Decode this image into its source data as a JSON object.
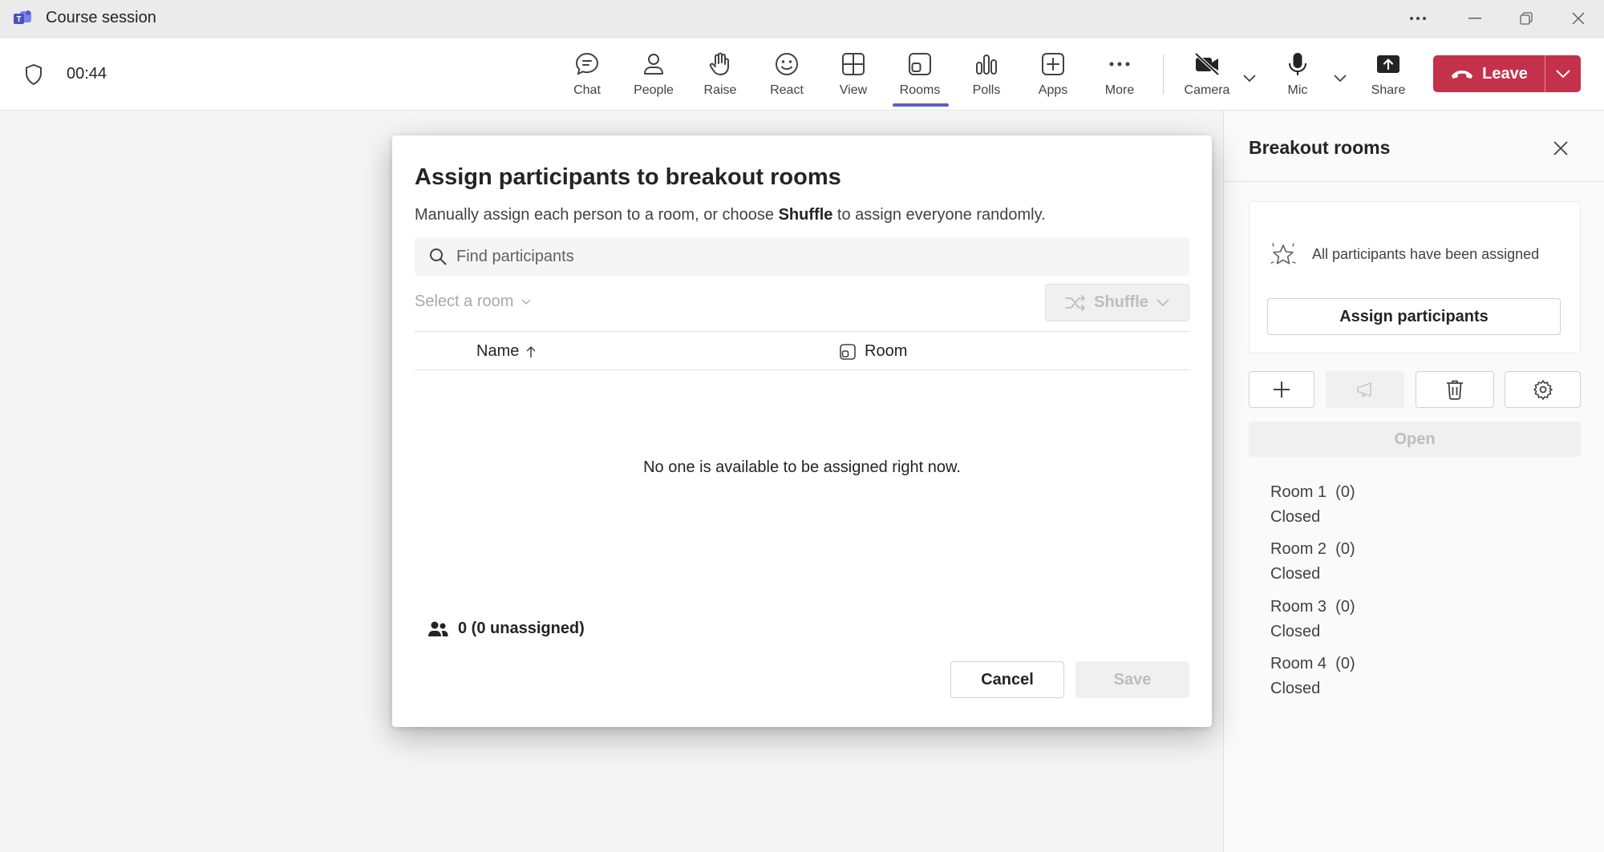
{
  "window": {
    "title": "Course session",
    "more_icon": "ellipsis-icon",
    "controls": [
      "minimize-icon",
      "restore-icon",
      "close-icon"
    ]
  },
  "toolbar": {
    "timer": "00:44",
    "buttons": [
      {
        "label": "Chat",
        "icon": "chat-icon"
      },
      {
        "label": "People",
        "icon": "people-icon"
      },
      {
        "label": "Raise",
        "icon": "hand-icon"
      },
      {
        "label": "React",
        "icon": "smiley-icon"
      },
      {
        "label": "View",
        "icon": "grid-icon"
      },
      {
        "label": "Rooms",
        "icon": "rooms-icon",
        "active": true
      },
      {
        "label": "Polls",
        "icon": "polls-icon"
      },
      {
        "label": "Apps",
        "icon": "plus-box-icon"
      },
      {
        "label": "More",
        "icon": "ellipsis-icon"
      },
      {
        "label": "Camera",
        "icon": "camera-off-icon"
      },
      {
        "label": "Mic",
        "icon": "mic-icon"
      },
      {
        "label": "Share",
        "icon": "share-icon"
      }
    ],
    "leave_label": "Leave",
    "accent": "#5b5fc7",
    "leave_color": "#c4314b"
  },
  "dialog": {
    "title": "Assign participants to breakout rooms",
    "description_pre": "Manually assign each person to a room, or choose ",
    "description_bold": "Shuffle",
    "description_post": " to assign everyone randomly.",
    "search_placeholder": "Find participants",
    "select_room_label": "Select a room",
    "shuffle_label": "Shuffle",
    "columns": {
      "name": "Name",
      "room": "Room"
    },
    "empty_message": "No one is available to be assigned right now.",
    "count_text": "0 (0 unassigned)",
    "cancel_label": "Cancel",
    "save_label": "Save"
  },
  "panel": {
    "title": "Breakout rooms",
    "assigned_text": "All participants have been assigned",
    "assign_button": "Assign participants",
    "open_button": "Open",
    "rooms": [
      {
        "name": "Room 1",
        "count": "(0)",
        "status": "Closed"
      },
      {
        "name": "Room 2",
        "count": "(0)",
        "status": "Closed"
      },
      {
        "name": "Room 3",
        "count": "(0)",
        "status": "Closed"
      },
      {
        "name": "Room 4",
        "count": "(0)",
        "status": "Closed"
      }
    ]
  }
}
